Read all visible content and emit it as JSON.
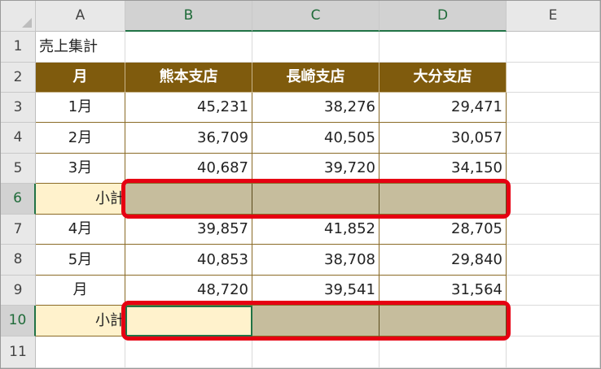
{
  "columns": [
    "A",
    "B",
    "C",
    "D",
    "E"
  ],
  "rows": [
    "1",
    "2",
    "3",
    "4",
    "5",
    "6",
    "7",
    "8",
    "9",
    "10",
    "11"
  ],
  "title": "売上集計",
  "headers": [
    "月",
    "熊本支店",
    "長崎支店",
    "大分支店"
  ],
  "data_rows": [
    {
      "month": "1月",
      "values": [
        "45,231",
        "38,276",
        "29,471"
      ]
    },
    {
      "month": "2月",
      "values": [
        "36,709",
        "40,505",
        "30,057"
      ]
    },
    {
      "month": "3月",
      "values": [
        "40,687",
        "39,720",
        "34,150"
      ]
    },
    {
      "subtotal": "小計"
    },
    {
      "month": "4月",
      "values": [
        "39,857",
        "41,852",
        "28,705"
      ]
    },
    {
      "month": "5月",
      "values": [
        "40,853",
        "38,708",
        "29,840"
      ]
    },
    {
      "month": "月",
      "values": [
        "48,720",
        "39,541",
        "31,564"
      ]
    },
    {
      "subtotal": "小計"
    }
  ],
  "selected_column_headers": [
    "B",
    "C",
    "D"
  ],
  "selected_row_headers": [
    "6",
    "10"
  ],
  "active_cell": "B10",
  "colors": {
    "header_fill": "#7f5b0d",
    "subtotal_fill": "#fff2cc",
    "selection_fill": "#c6bd9d",
    "highlight_border": "#e60012",
    "excel_green": "#217346"
  }
}
